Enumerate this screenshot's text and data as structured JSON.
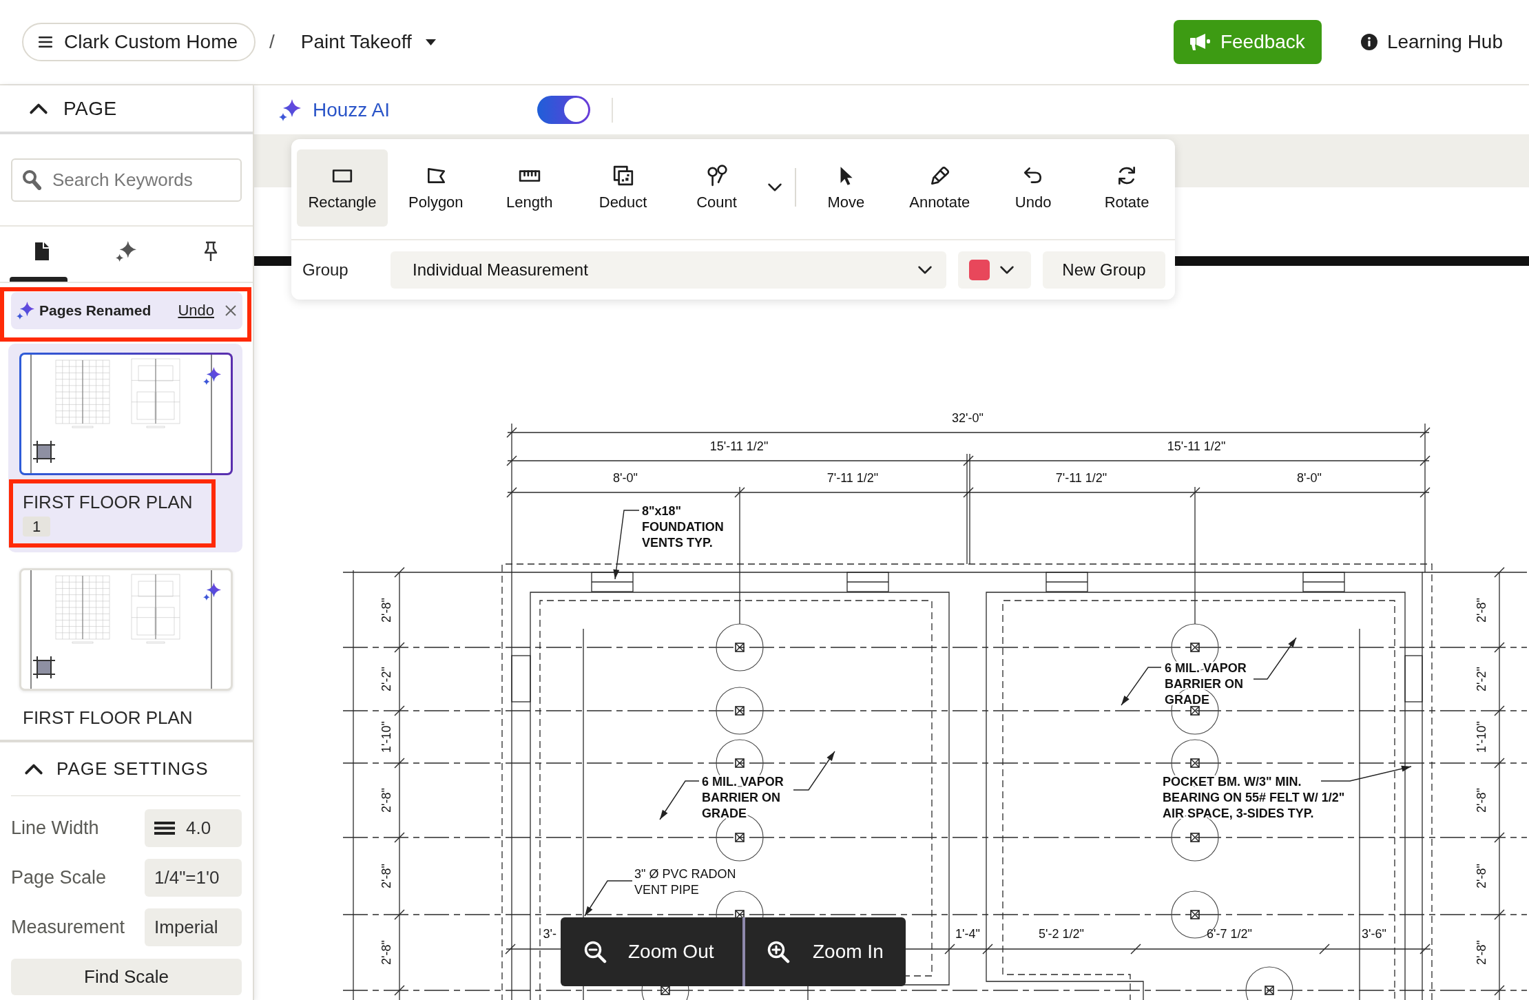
{
  "header": {
    "project": "Clark Custom Home",
    "separator": "/",
    "takeoff": "Paint Takeoff",
    "feedback": "Feedback",
    "help": "Learning Hub"
  },
  "page_section": {
    "title": "PAGE",
    "expanded": true
  },
  "search": {
    "placeholder": "Search Keywords"
  },
  "panel_tabs": [
    {
      "kind": "document",
      "selected": true
    },
    {
      "kind": "sparkle",
      "selected": false
    },
    {
      "kind": "pin",
      "selected": false
    }
  ],
  "notice": {
    "text": "Pages Renamed",
    "action": "Undo",
    "highlighted": true
  },
  "pages": [
    {
      "title": "FIRST FLOOR PLAN",
      "number": "1",
      "selected": true,
      "highlighted": true
    },
    {
      "title": "FIRST FLOOR PLAN",
      "selected": false,
      "highlighted": false
    }
  ],
  "page_settings": {
    "title": "PAGE SETTINGS",
    "expanded": true,
    "fields": [
      {
        "label": "Line Width",
        "value": "4.0",
        "kind": "line-width"
      },
      {
        "label": "Page Scale",
        "value": "1/4\"=1'0",
        "kind": "text"
      },
      {
        "label": "Measurement",
        "value": "Imperial",
        "kind": "text"
      }
    ],
    "find_scale": "Find Scale"
  },
  "ai": {
    "label": "Houzz AI",
    "on": true
  },
  "toolbar": {
    "tools": [
      {
        "kind": "rectangle",
        "label": "Rectangle",
        "selected": true
      },
      {
        "kind": "polygon",
        "label": "Polygon",
        "selected": false
      },
      {
        "kind": "length",
        "label": "Length",
        "selected": false
      },
      {
        "kind": "deduct",
        "label": "Deduct",
        "selected": false
      },
      {
        "kind": "count",
        "label": "Count",
        "selected": false
      }
    ],
    "edit_tools": [
      {
        "kind": "move",
        "label": "Move",
        "selected": false
      },
      {
        "kind": "annotate",
        "label": "Annotate",
        "selected": false
      },
      {
        "kind": "undo",
        "label": "Undo",
        "selected": false
      },
      {
        "kind": "rotate",
        "label": "Rotate",
        "selected": false
      }
    ],
    "group": {
      "label": "Group",
      "value": "Individual Measurement",
      "color": "#e8475b"
    },
    "new_group": "New Group"
  },
  "plan": {
    "top_dimensions": [
      "32'-0\"",
      "15'-11 1/2\"",
      "15'-11 1/2\"",
      "8'-0\"",
      "7'-11 1/2\"",
      "7'-11 1/2\"",
      "8'-0\""
    ],
    "left_dimensions": [
      "2'-8\"",
      "2'-2\"",
      "1'-10\"",
      "2'-8\"",
      "2'-8\"",
      "2'-8\""
    ],
    "right_dimensions": [
      "2'-8\"",
      "2'-2\"",
      "1'-10\"",
      "2'-8\"",
      "2'-8\"",
      "2'-8\""
    ],
    "bottom_dimensions": [
      "3'-",
      "1'-4\"",
      "5'-2 1/2\"",
      "6'-7 1/2\"",
      "3'-6\""
    ],
    "notes": [
      {
        "lines": [
          "8\"x18\"",
          "FOUNDATION",
          "VENTS TYP."
        ]
      },
      {
        "lines": [
          "6 MIL. VAPOR",
          "BARRIER ON",
          "GRADE"
        ]
      },
      {
        "lines": [
          "6 MIL. VAPOR",
          "BARRIER ON",
          "GRADE"
        ]
      },
      {
        "lines": [
          "POCKET BM. W/3\" MIN.",
          "BEARING ON 55# FELT W/ 1/2\"",
          "AIR SPACE, 3-SIDES TYP."
        ]
      },
      {
        "lines": [
          "3\" Ø PVC RADON",
          "VENT PIPE"
        ]
      }
    ]
  },
  "zoom": {
    "out": "Zoom Out",
    "in": "Zoom In"
  }
}
